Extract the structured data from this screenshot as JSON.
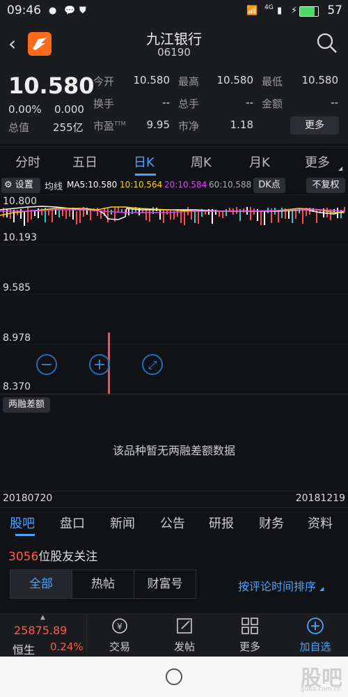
{
  "status": {
    "time": "09:46",
    "battery": "57",
    "net": "4G"
  },
  "header": {
    "title": "九江银行",
    "code": "06190"
  },
  "quote": {
    "price": "10.580",
    "pct": "0.00%",
    "chg": "0.000",
    "mcap_label": "总值",
    "mcap_val": "255亿",
    "rows": [
      [
        {
          "l": "今开",
          "v": "10.580"
        },
        {
          "l": "最高",
          "v": "10.580"
        },
        {
          "l": "最低",
          "v": "10.580"
        }
      ],
      [
        {
          "l": "换手",
          "v": "--"
        },
        {
          "l": "总手",
          "v": "--"
        },
        {
          "l": "金额",
          "v": "--"
        }
      ],
      [
        {
          "l": "市盈",
          "sup": "TTM",
          "v": "9.95"
        },
        {
          "l": "市净",
          "v": "1.18"
        }
      ]
    ],
    "more": "更多"
  },
  "tabs": [
    "分时",
    "五日",
    "日K",
    "周K",
    "月K",
    "更多"
  ],
  "active_tab": "日K",
  "ma": {
    "settings": "设置",
    "label": "均线",
    "ma5": "MA5:10.580",
    "ma10": "10:10.564",
    "ma20": "20:10.584",
    "ma60": "60:10.588",
    "dk": "DK点",
    "fq": "不复权",
    "colors": {
      "ma5": "#ffffff",
      "ma10": "#ffd700",
      "ma20": "#e040fb",
      "ma60": "#aaaaaa"
    }
  },
  "chart_data": {
    "type": "candlestick",
    "y_ticks": [
      "10.800",
      "10.193",
      "9.585",
      "8.978",
      "8.370"
    ],
    "ylim": [
      8.37,
      10.8
    ],
    "x_start": "20180720",
    "x_end": "20181219",
    "colors": {
      "up": "#ff4d4d",
      "down": "#33cccc"
    }
  },
  "zoom": {
    "minus": "−",
    "plus": "+"
  },
  "margin": {
    "label": "两融差额",
    "empty": "该品种暂无两融差额数据"
  },
  "dates": {
    "start": "20180720",
    "end": "20181219"
  },
  "subtabs": [
    "股吧",
    "盘口",
    "新闻",
    "公告",
    "研报",
    "财务",
    "资料"
  ],
  "followers": {
    "count": "3056",
    "text": "位股友关注"
  },
  "filters": [
    "全部",
    "热帖",
    "财富号"
  ],
  "sort": "按评论时间排序",
  "index": {
    "value": "25875.89",
    "name": "恒生",
    "pct": "0.24%"
  },
  "bottom_nav": [
    "交易",
    "发帖",
    "更多",
    "加自选"
  ],
  "watermark": {
    "text": "股吧",
    "url": "guba.com.cn"
  }
}
